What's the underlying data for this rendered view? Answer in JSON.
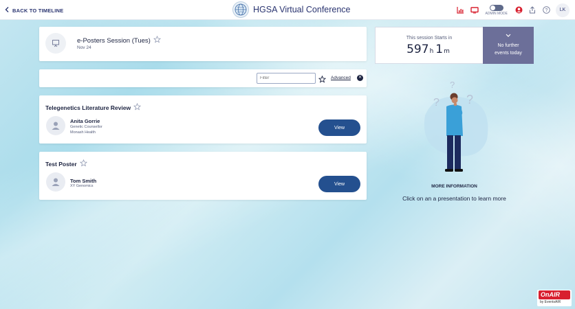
{
  "header": {
    "back_label": "BACK TO TIMELINE",
    "title": "HGSA Virtual Conference",
    "admin_mode_label": "ADMIN MODE",
    "user_initials": "LK",
    "icons": [
      "chart-icon",
      "monitor-icon",
      "person-icon",
      "share-icon",
      "help-icon"
    ],
    "accent_color": "#d8202f"
  },
  "session": {
    "title": "e-Posters Session (Tues)",
    "date": "Nov 24"
  },
  "filter_bar": {
    "placeholder": "Filter",
    "advanced_label": "Advanced"
  },
  "presentations": [
    {
      "title": "Telegenetics Literature Review",
      "presenter": "Anita Gorrie",
      "role": "Genetic Counsellor",
      "org": "Monash Health",
      "button": "View"
    },
    {
      "title": "Test Poster",
      "presenter": "Tom Smith",
      "role": "XY Genomics",
      "button": "View"
    }
  ],
  "countdown": {
    "label": "This session Starts in",
    "hours": "597",
    "hours_unit": "h",
    "minutes": "1",
    "minutes_unit": "m"
  },
  "next_events": {
    "text_line1": "No further",
    "text_line2": "events today",
    "panel_color": "#6c6f99"
  },
  "info": {
    "heading": "MORE INFORMATION",
    "text": "Click on an a presentation to learn more"
  },
  "footer_logo": {
    "brand": "OnAIR",
    "sub": "by EventsAIR"
  },
  "colors": {
    "primary_button": "#24508f",
    "text_dark": "#1c2340"
  }
}
